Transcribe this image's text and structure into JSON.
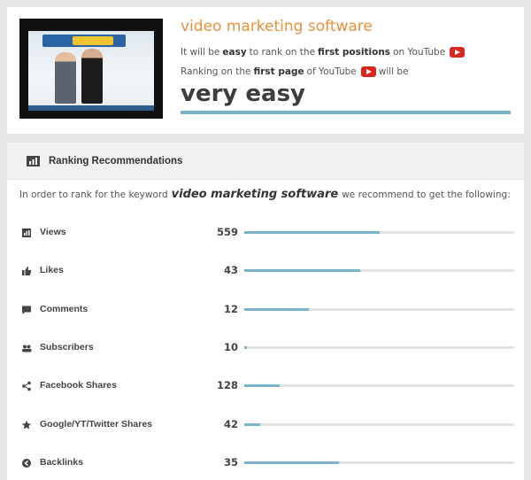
{
  "video": {
    "keyword": "video marketing software",
    "line1": {
      "pre": "It will be",
      "b1": "easy",
      "mid": "to rank on the",
      "b2": "first positions",
      "post": "on YouTube"
    },
    "line2": {
      "pre": "Ranking on the",
      "b1": "first page",
      "mid": "of YouTube",
      "post": "will be"
    },
    "difficulty": "very easy",
    "difficulty_level": 1.0,
    "youtube_icon": "youtube-play-icon"
  },
  "ranking": {
    "title": "Ranking Recommendations",
    "intro_pre": "In order to rank for the keyword",
    "intro_keyword": "video marketing software",
    "intro_post": "we recommend to get the following:",
    "metrics": [
      {
        "icon": "chart-icon",
        "label": "Views",
        "value": "559",
        "fill": 0.5
      },
      {
        "icon": "thumbs-up-icon",
        "label": "Likes",
        "value": "43",
        "fill": 0.43
      },
      {
        "icon": "comment-icon",
        "label": "Comments",
        "value": "12",
        "fill": 0.24
      },
      {
        "icon": "users-icon",
        "label": "Subscribers",
        "value": "10",
        "fill": 0.01
      },
      {
        "icon": "share-icon",
        "label": "Facebook Shares",
        "value": "128",
        "fill": 0.13
      },
      {
        "icon": "star-icon",
        "label": "Google/YT/Twitter Shares",
        "value": "42",
        "fill": 0.06
      },
      {
        "icon": "backlink-icon",
        "label": "Backlinks",
        "value": "35",
        "fill": 0.35
      }
    ]
  },
  "colors": {
    "accent": "#e8903a",
    "bar": "#7ab4c8",
    "track": "#e1e1e1",
    "youtube": "#d9281e"
  }
}
